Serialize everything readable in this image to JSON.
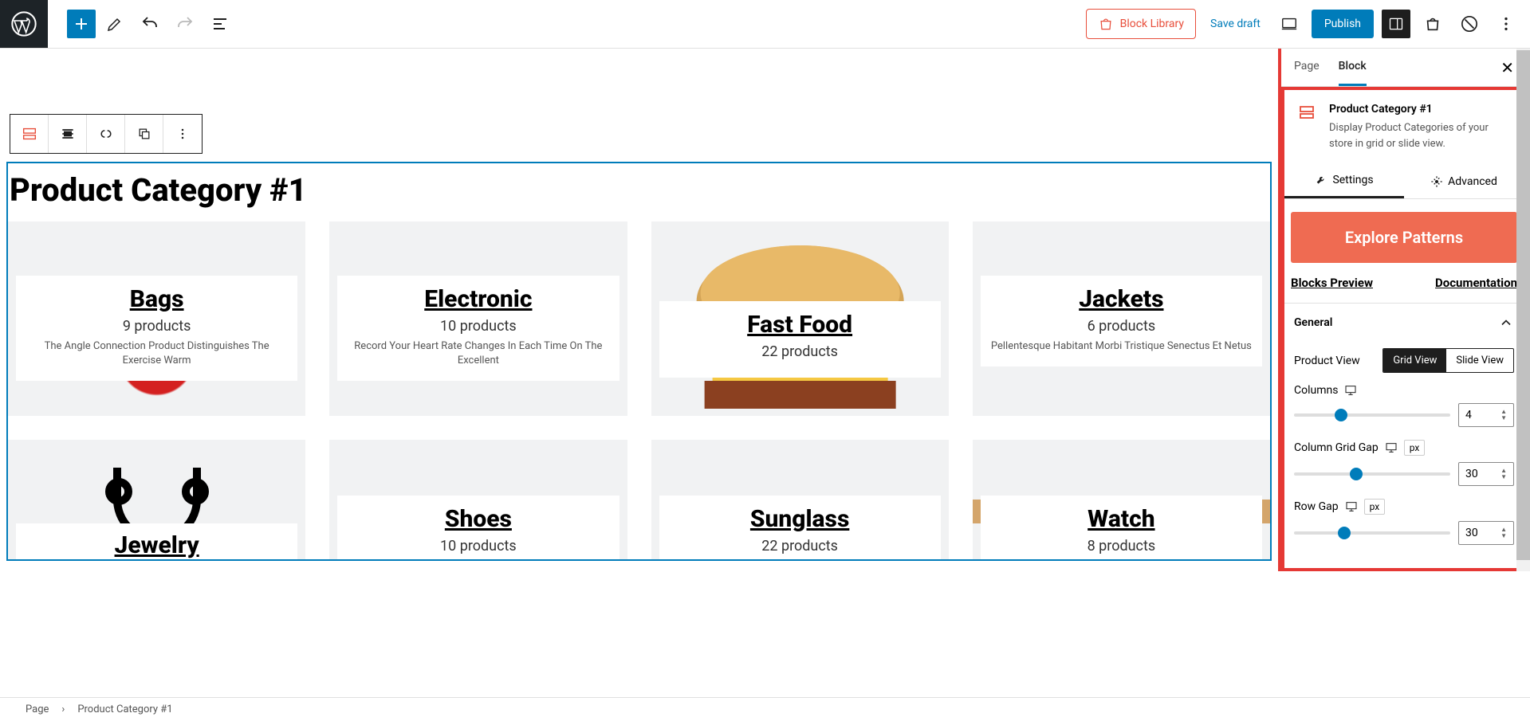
{
  "topbar": {
    "block_library": "Block Library",
    "save_draft": "Save draft",
    "publish": "Publish"
  },
  "block_title": "Product Category #1",
  "products": [
    {
      "name": "Bags",
      "count": "9 products",
      "desc": "The Angle Connection Product Distinguishes The Exercise Warm"
    },
    {
      "name": "Electronic",
      "count": "10 products",
      "desc": "Record Your Heart Rate Changes In Each Time On The Excellent"
    },
    {
      "name": "Fast Food",
      "count": "22 products",
      "desc": ""
    },
    {
      "name": "Jackets",
      "count": "6 products",
      "desc": "Pellentesque Habitant Morbi Tristique Senectus Et Netus"
    },
    {
      "name": "Jewelry",
      "count": "",
      "desc": ""
    },
    {
      "name": "Shoes",
      "count": "10 products",
      "desc": ""
    },
    {
      "name": "Sunglass",
      "count": "22 products",
      "desc": ""
    },
    {
      "name": "Watch",
      "count": "8 products",
      "desc": ""
    }
  ],
  "sidebar": {
    "tab_page": "Page",
    "tab_block": "Block",
    "block_name": "Product Category #1",
    "block_desc": "Display Product Categories of your store in grid or slide view.",
    "tab_settings": "Settings",
    "tab_advanced": "Advanced",
    "explore": "Explore Patterns",
    "blocks_preview": "Blocks Preview",
    "documentation": "Documentation",
    "general": "General",
    "product_view": "Product View",
    "grid_view": "Grid View",
    "slide_view": "Slide View",
    "columns": "Columns",
    "columns_val": "4",
    "column_gap": "Column Grid Gap",
    "column_gap_val": "30",
    "row_gap": "Row Gap",
    "row_gap_val": "30",
    "px": "px"
  },
  "breadcrumb": {
    "page": "Page",
    "block": "Product Category #1"
  }
}
